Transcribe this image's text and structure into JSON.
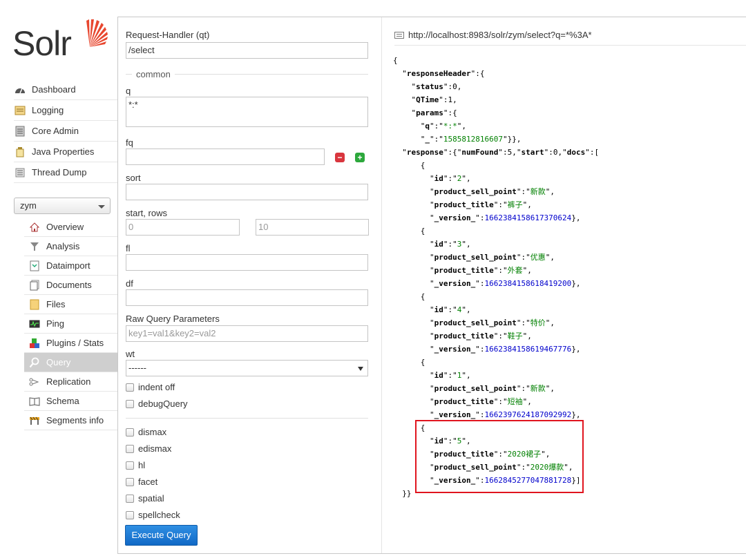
{
  "app": {
    "logo_text": "Solr"
  },
  "sidebar": {
    "items": [
      {
        "label": "Dashboard",
        "icon": "dashboard-icon"
      },
      {
        "label": "Logging",
        "icon": "logging-icon"
      },
      {
        "label": "Core Admin",
        "icon": "core-admin-icon"
      },
      {
        "label": "Java Properties",
        "icon": "java-icon"
      },
      {
        "label": "Thread Dump",
        "icon": "thread-dump-icon"
      }
    ],
    "core_selector": "zym",
    "core_items": [
      {
        "label": "Overview",
        "icon": "overview-icon"
      },
      {
        "label": "Analysis",
        "icon": "analysis-icon"
      },
      {
        "label": "Dataimport",
        "icon": "dataimport-icon"
      },
      {
        "label": "Documents",
        "icon": "documents-icon"
      },
      {
        "label": "Files",
        "icon": "files-icon"
      },
      {
        "label": "Ping",
        "icon": "ping-icon"
      },
      {
        "label": "Plugins / Stats",
        "icon": "plugins-icon"
      },
      {
        "label": "Query",
        "icon": "query-icon",
        "active": true
      },
      {
        "label": "Replication",
        "icon": "replication-icon"
      },
      {
        "label": "Schema",
        "icon": "schema-icon"
      },
      {
        "label": "Segments info",
        "icon": "segments-icon"
      }
    ]
  },
  "form": {
    "request_handler_label": "Request-Handler (qt)",
    "request_handler_value": "/select",
    "common_legend": "common",
    "q_label": "q",
    "q_value": "*:*",
    "fq_label": "fq",
    "fq_value": "",
    "sort_label": "sort",
    "sort_value": "",
    "start_rows_label": "start, rows",
    "start_value": "0",
    "rows_value": "10",
    "fl_label": "fl",
    "fl_value": "",
    "df_label": "df",
    "df_value": "",
    "raw_label": "Raw Query Parameters",
    "raw_placeholder": "key1=val1&key2=val2",
    "wt_label": "wt",
    "wt_value": "------",
    "indent_label": "indent off",
    "debug_label": "debugQuery",
    "dismax_label": "dismax",
    "edismax_label": "edismax",
    "hl_label": "hl",
    "facet_label": "facet",
    "spatial_label": "spatial",
    "spellcheck_label": "spellcheck",
    "execute_label": "Execute Query"
  },
  "result": {
    "url": "http://localhost:8983/solr/zym/select?q=*%3A*",
    "qtime": "1",
    "status": "0",
    "params_q": "*:*",
    "params_underscore": "1585812816607",
    "num_found": "5",
    "start": "0",
    "docs": [
      {
        "id": "2",
        "sell_point": "新款",
        "title": "裤子",
        "version": "1662384158617370624"
      },
      {
        "id": "3",
        "sell_point": "优惠",
        "title": "外套",
        "version": "1662384158618419200"
      },
      {
        "id": "4",
        "sell_point": "特价",
        "title": "鞋子",
        "version": "1662384158619467776"
      },
      {
        "id": "1",
        "sell_point": "新款",
        "title": "短袖",
        "version": "1662397624187092992"
      },
      {
        "id": "5",
        "title": "2020裙子",
        "sell_point": "2020爆款",
        "version": "1662845277047881728"
      }
    ]
  },
  "colors": {
    "accent": "#1a73d0",
    "highlight_border": "#e0141e",
    "logo_orange": "#e8472f"
  }
}
